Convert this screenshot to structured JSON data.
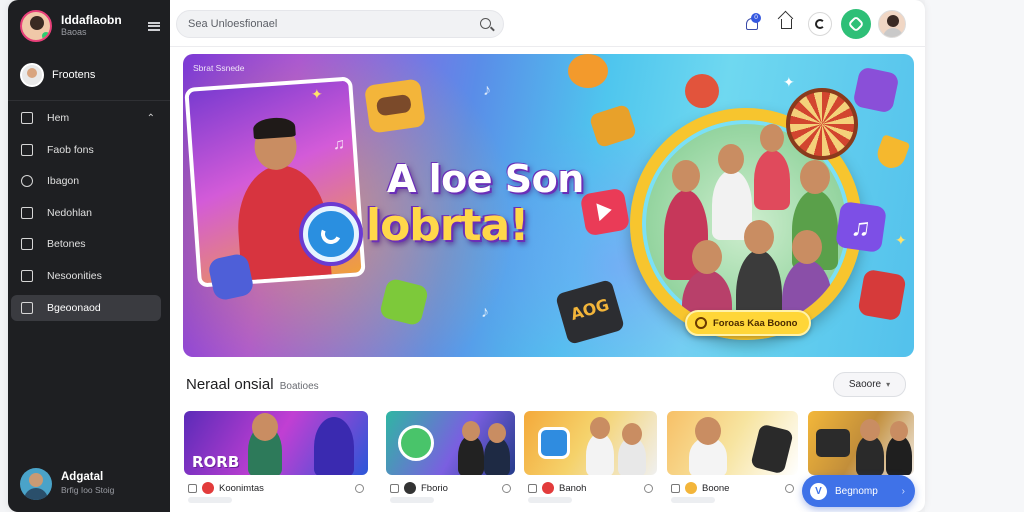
{
  "sidebar": {
    "brand_title": "Iddaflaobn",
    "brand_subtitle": "Baoas",
    "profile_name": "Frootens",
    "items": [
      {
        "label": "Hem",
        "icon": "home-icon",
        "has_chevron": true,
        "active": false
      },
      {
        "label": "Faob fons",
        "icon": "folder-icon",
        "active": false
      },
      {
        "label": "Ibagon",
        "icon": "search-icon",
        "active": false
      },
      {
        "label": "Nedohlan",
        "icon": "calendar-icon",
        "active": false
      },
      {
        "label": "Betones",
        "icon": "bookmark-icon",
        "active": false
      },
      {
        "label": "Nesoonities",
        "icon": "community-icon",
        "active": false
      },
      {
        "label": "Bgeoonaod",
        "icon": "settings-icon",
        "active": true
      }
    ],
    "user": {
      "name": "Adgatal",
      "subtitle": "Brfig Ioo Stoig"
    }
  },
  "header": {
    "search_placeholder": "Sea Unloesfionael",
    "notification_count": "0"
  },
  "banner": {
    "tag": "Sbrat Ssnede",
    "headline": "A loe Son",
    "subheadline": "lobrta!",
    "camera_text": "AOG",
    "pill_label": "Foroas Kaa Boono"
  },
  "section": {
    "title": "Neraal onsial",
    "title_suffix": "Boatioes",
    "sort_label": "Saoore"
  },
  "cards": [
    {
      "thumb_text": "RORB",
      "label": "Koonimtas"
    },
    {
      "thumb_text": "",
      "label": "Fborio"
    },
    {
      "thumb_text": "",
      "label": "Banoh"
    },
    {
      "thumb_text": "",
      "label": "Boone"
    },
    {
      "thumb_text": "",
      "label": ""
    }
  ],
  "fab": {
    "label": "Begnomp"
  },
  "colors": {
    "sidebar_bg": "#1e1f22",
    "accent_blue": "#3f72e8",
    "accent_green": "#2ebf77",
    "banner_yellow": "#ffd638"
  }
}
